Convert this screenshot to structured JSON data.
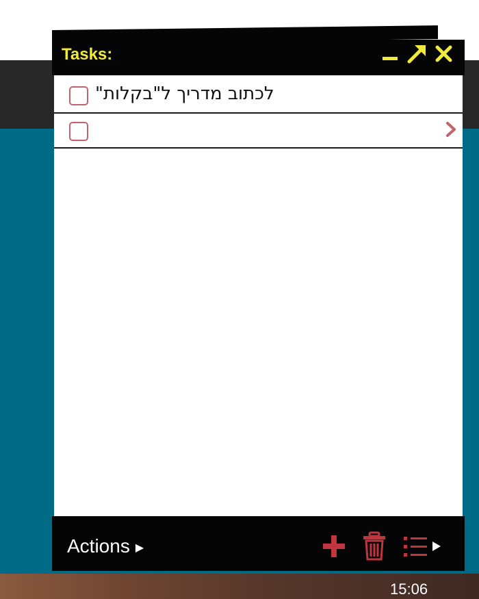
{
  "gadget": {
    "title": "Tasks:",
    "title_color": "#f2ea3a",
    "header_buttons": [
      "minimize-icon",
      "expand-icon",
      "close-icon"
    ]
  },
  "tasks": [
    {
      "text": "לכתוב מדריך ל\"בקלות\"",
      "checked": false
    },
    {
      "text": "",
      "checked": false
    }
  ],
  "footer": {
    "actions_label": "Actions",
    "icons": [
      "add-icon",
      "trash-icon",
      "list-menu-icon"
    ],
    "accent_color": "#c0363f"
  },
  "taskbar": {
    "clock": "15:06"
  },
  "colors": {
    "desktop": "#006b86",
    "checkbox": "#c0636a"
  }
}
